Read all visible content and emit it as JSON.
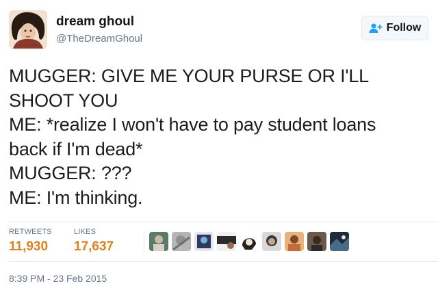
{
  "author": {
    "name": "dream ghoul",
    "handle": "@TheDreamGhoul"
  },
  "follow_button": {
    "label": "Follow",
    "icon": "follow-user-icon",
    "accent": "#1da1f2"
  },
  "tweet": {
    "lines": [
      "MUGGER: GIVE ME YOUR PURSE OR I'LL",
      "SHOOT YOU",
      "ME: *realize I won't have to pay student loans",
      "back if I'm dead*",
      "MUGGER: ???",
      "ME: I'm thinking."
    ]
  },
  "stats": {
    "retweets_label": "RETWEETS",
    "retweets_value": "11,930",
    "likes_label": "LIKES",
    "likes_value": "17,637",
    "value_color": "#e0811e"
  },
  "likers_count_shown": 9,
  "timestamp": "8:39 PM - 23 Feb 2015"
}
